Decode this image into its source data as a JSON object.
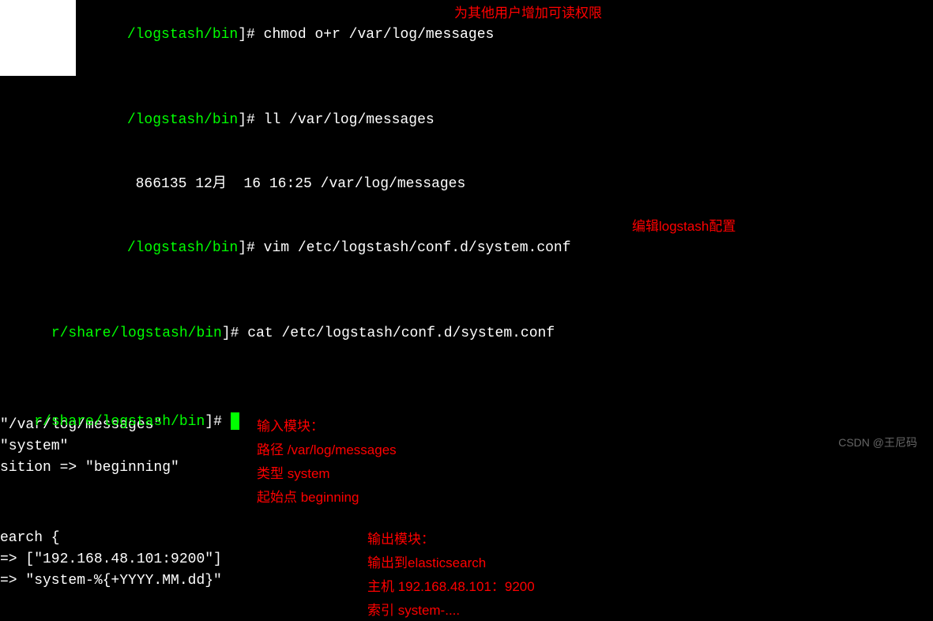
{
  "top": {
    "prompt1_path": "/logstash/bin",
    "prompt1_end": "]# ",
    "cmd1": "chmod o+r /var/log/messages",
    "anno1": "为其他用户增加可读权限",
    "prompt2_path": "/logstash/bin",
    "prompt2_end": "]# ",
    "cmd2": "ll /var/log/messages",
    "output_ll": " 866135 12月  16 16:25 /var/log/messages",
    "prompt3_path": "/logstash/bin",
    "prompt3_end": "]# ",
    "cmd3": "vim /etc/logstash/conf.d/system.conf",
    "anno2": "编辑logstash配置",
    "prompt4_path": "r/share/logstash/bin",
    "prompt4_end": "]# ",
    "cmd4": "cat /etc/logstash/conf.d/system.conf"
  },
  "block1": {
    "line1": "\"/var/log/messages\"",
    "line2": "\"system\"",
    "line3": "sition => \"beginning\"",
    "anno_line1": "输入模块：",
    "anno_line2": "路径 /var/log/messages",
    "anno_line3": "类型 system",
    "anno_line4": "起始点 beginning"
  },
  "block2": {
    "line1": "earch {",
    "line2": "=> [\"192.168.48.101:9200\"]",
    "line3": "=> \"system-%{+YYYY.MM.dd}\"",
    "anno_line1": "输出模块：",
    "anno_line2": "输出到elasticsearch",
    "anno_line3": "主机 192.168.48.101：9200",
    "anno_line4": "索引 system-...."
  },
  "bottom": {
    "prompt_path": "r/share/logstash/bin",
    "prompt_end": "]# "
  },
  "watermark": "CSDN @王尼码"
}
